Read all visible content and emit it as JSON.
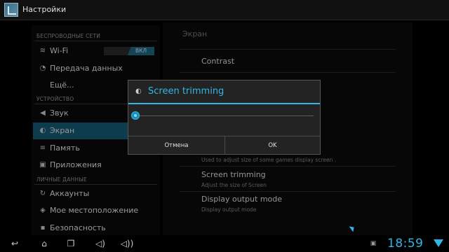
{
  "app": {
    "title": "Настройки"
  },
  "sidebar": {
    "sections": {
      "wireless": "БЕСПРОВОДНЫЕ СЕТИ",
      "device": "УСТРОЙСТВО",
      "personal": "ЛИЧНЫЕ ДАННЫЕ"
    },
    "items": {
      "wifi": "Wi-Fi",
      "wifi_toggle": "ВКЛ",
      "data": "Передача данных",
      "more": "Ещё...",
      "sound": "Звук",
      "display": "Экран",
      "memory": "Память",
      "apps": "Приложения",
      "accounts": "Аккаунты",
      "location": "Мое местоположение",
      "security": "Безопасность"
    }
  },
  "panel": {
    "title": "Экран",
    "contrast": "Contrast",
    "used_to": "Used to adjust size of some games display screen .",
    "trimming": "Screen trimming",
    "trimming_sub": "Adjust the size of Screen",
    "output": "Display output mode",
    "output_sub": "Display output mode"
  },
  "dialog": {
    "title": "Screen trimming",
    "slider_value": 0,
    "cancel": "Отмена",
    "ok": "OK"
  },
  "status": {
    "time": "18:59"
  },
  "colors": {
    "accent": "#33b5e5",
    "selected": "#155c77"
  },
  "icons": [
    "back-icon",
    "home-icon",
    "recent-apps-icon",
    "volume-down-icon",
    "volume-up-icon",
    "screenshot-icon",
    "wifi-icon"
  ]
}
